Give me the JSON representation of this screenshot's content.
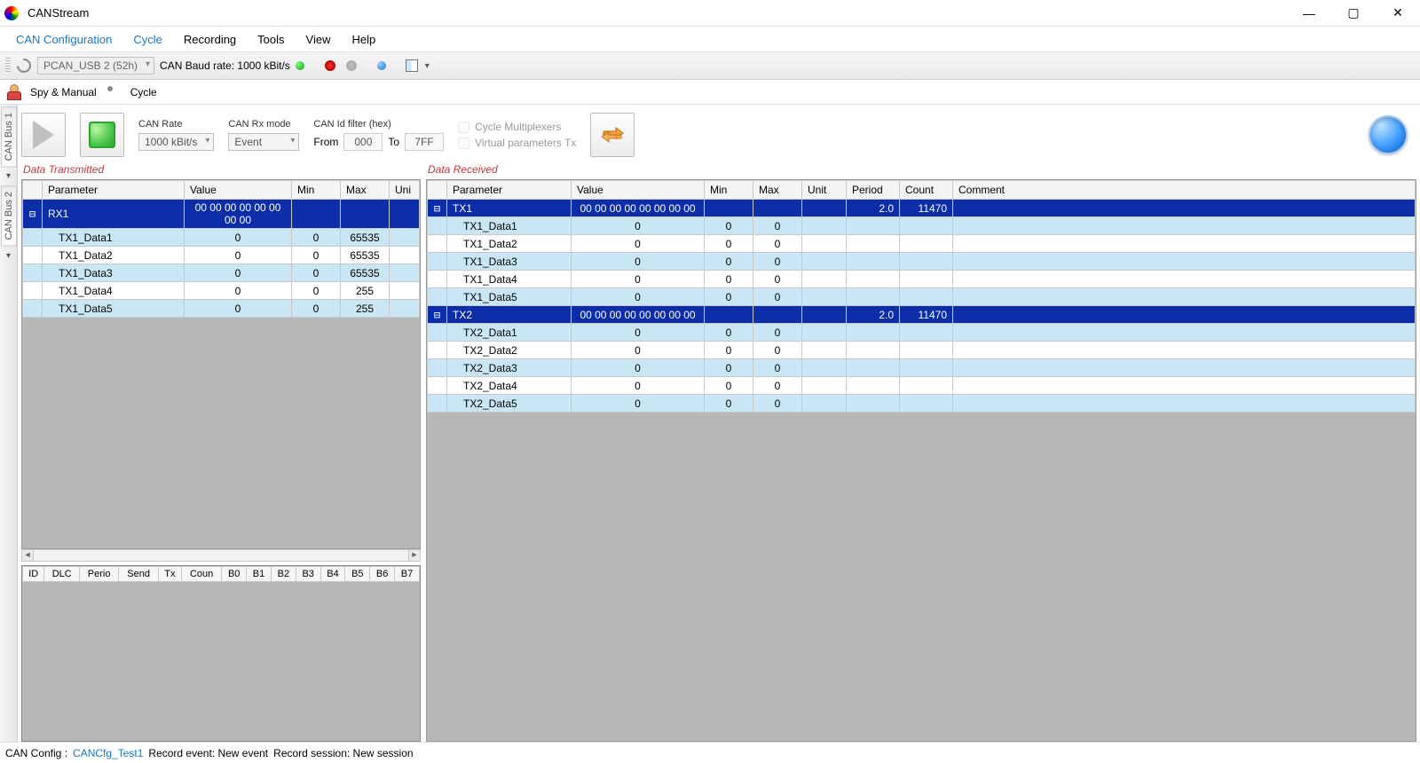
{
  "window": {
    "title": "CANStream"
  },
  "menus": [
    "CAN Configuration",
    "Cycle",
    "Recording",
    "Tools",
    "View",
    "Help"
  ],
  "menus_hl": [
    true,
    true,
    false,
    false,
    false,
    false
  ],
  "toolbar": {
    "device": "PCAN_USB 2 (52h)",
    "baud_label": "CAN Baud rate: 1000 kBit/s"
  },
  "subtabs": {
    "tab1": "Spy & Manual",
    "tab2": "Cycle"
  },
  "sidebar": {
    "bus1": "CAN Bus 1",
    "bus2": "CAN Bus 2"
  },
  "controls": {
    "can_rate_label": "CAN Rate",
    "can_rate_value": "1000 kBit/s",
    "rx_mode_label": "CAN Rx mode",
    "rx_mode_value": "Event",
    "filter_label": "CAN Id filter (hex)",
    "from_label": "From",
    "from_value": "000",
    "to_label": "To",
    "to_value": "7FF",
    "chk_multiplex": "Cycle Multiplexers",
    "chk_virtual": "Virtual parameters Tx"
  },
  "tx": {
    "title": "Data Transmitted",
    "cols": [
      "",
      "Parameter",
      "Value",
      "Min",
      "Max",
      "Uni"
    ],
    "rows": [
      {
        "hdr": true,
        "alt": false,
        "tog": "⊟",
        "p": "RX1",
        "v": "00 00 00 00 00 00 00 00",
        "min": "",
        "max": "",
        "u": ""
      },
      {
        "hdr": false,
        "alt": true,
        "tog": "",
        "p": "TX1_Data1",
        "v": "0",
        "min": "0",
        "max": "65535",
        "u": ""
      },
      {
        "hdr": false,
        "alt": false,
        "tog": "",
        "p": "TX1_Data2",
        "v": "0",
        "min": "0",
        "max": "65535",
        "u": ""
      },
      {
        "hdr": false,
        "alt": true,
        "tog": "",
        "p": "TX1_Data3",
        "v": "0",
        "min": "0",
        "max": "65535",
        "u": ""
      },
      {
        "hdr": false,
        "alt": false,
        "tog": "",
        "p": "TX1_Data4",
        "v": "0",
        "min": "0",
        "max": "255",
        "u": ""
      },
      {
        "hdr": false,
        "alt": true,
        "tog": "",
        "p": "TX1_Data5",
        "v": "0",
        "min": "0",
        "max": "255",
        "u": ""
      }
    ]
  },
  "rx": {
    "title": "Data Received",
    "cols": [
      "",
      "Parameter",
      "Value",
      "Min",
      "Max",
      "Unit",
      "Period",
      "Count",
      "Comment"
    ],
    "rows": [
      {
        "hdr": true,
        "alt": false,
        "tog": "⊟",
        "p": "TX1",
        "v": "00 00 00 00 00 00 00 00",
        "min": "",
        "max": "",
        "u": "",
        "per": "2.0",
        "cnt": "11470",
        "cm": ""
      },
      {
        "hdr": false,
        "alt": true,
        "tog": "",
        "p": "TX1_Data1",
        "v": "0",
        "min": "0",
        "max": "0",
        "u": "",
        "per": "",
        "cnt": "",
        "cm": ""
      },
      {
        "hdr": false,
        "alt": false,
        "tog": "",
        "p": "TX1_Data2",
        "v": "0",
        "min": "0",
        "max": "0",
        "u": "",
        "per": "",
        "cnt": "",
        "cm": ""
      },
      {
        "hdr": false,
        "alt": true,
        "tog": "",
        "p": "TX1_Data3",
        "v": "0",
        "min": "0",
        "max": "0",
        "u": "",
        "per": "",
        "cnt": "",
        "cm": ""
      },
      {
        "hdr": false,
        "alt": false,
        "tog": "",
        "p": "TX1_Data4",
        "v": "0",
        "min": "0",
        "max": "0",
        "u": "",
        "per": "",
        "cnt": "",
        "cm": ""
      },
      {
        "hdr": false,
        "alt": true,
        "tog": "",
        "p": "TX1_Data5",
        "v": "0",
        "min": "0",
        "max": "0",
        "u": "",
        "per": "",
        "cnt": "",
        "cm": ""
      },
      {
        "hdr": true,
        "alt": false,
        "tog": "⊟",
        "p": "TX2",
        "v": "00 00 00 00 00 00 00 00",
        "min": "",
        "max": "",
        "u": "",
        "per": "2.0",
        "cnt": "11470",
        "cm": ""
      },
      {
        "hdr": false,
        "alt": true,
        "tog": "",
        "p": "TX2_Data1",
        "v": "0",
        "min": "0",
        "max": "0",
        "u": "",
        "per": "",
        "cnt": "",
        "cm": ""
      },
      {
        "hdr": false,
        "alt": false,
        "tog": "",
        "p": "TX2_Data2",
        "v": "0",
        "min": "0",
        "max": "0",
        "u": "",
        "per": "",
        "cnt": "",
        "cm": ""
      },
      {
        "hdr": false,
        "alt": true,
        "tog": "",
        "p": "TX2_Data3",
        "v": "0",
        "min": "0",
        "max": "0",
        "u": "",
        "per": "",
        "cnt": "",
        "cm": ""
      },
      {
        "hdr": false,
        "alt": false,
        "tog": "",
        "p": "TX2_Data4",
        "v": "0",
        "min": "0",
        "max": "0",
        "u": "",
        "per": "",
        "cnt": "",
        "cm": ""
      },
      {
        "hdr": false,
        "alt": true,
        "tog": "",
        "p": "TX2_Data5",
        "v": "0",
        "min": "0",
        "max": "0",
        "u": "",
        "per": "",
        "cnt": "",
        "cm": ""
      }
    ]
  },
  "raw_cols": [
    "ID",
    "DLC",
    "Perio",
    "Send",
    "Tx",
    "Coun",
    "B0",
    "B1",
    "B2",
    "B3",
    "B4",
    "B5",
    "B6",
    "B7"
  ],
  "status": {
    "prefix": "CAN Config :",
    "link": "CANCfg_Test1",
    "event": "Record event: New event",
    "session": "Record session: New session"
  }
}
